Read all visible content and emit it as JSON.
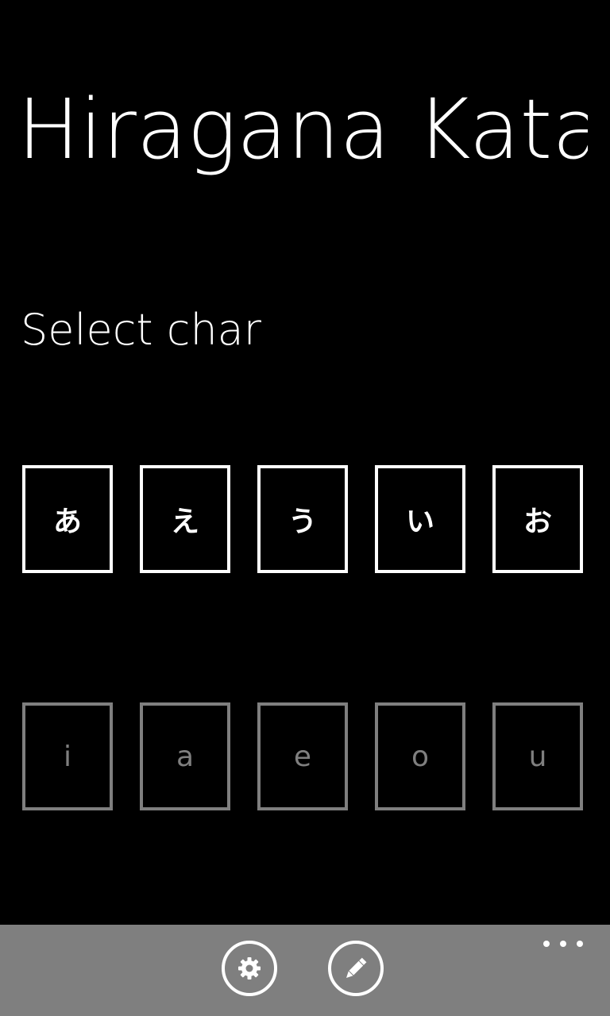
{
  "app": {
    "title": "Hiragana Katakana",
    "subtitle": "Select char"
  },
  "kana_tiles": [
    "あ",
    "え",
    "う",
    "い",
    "お"
  ],
  "romaji_tiles": [
    "i",
    "a",
    "e",
    "o",
    "u"
  ],
  "appbar": {
    "icons": [
      "gear-icon",
      "pencil-icon",
      "more-icon"
    ]
  },
  "colors": {
    "background": "#000000",
    "foreground": "#ffffff",
    "disabled": "#7f7f7f",
    "appbar": "#7f7f7f"
  }
}
